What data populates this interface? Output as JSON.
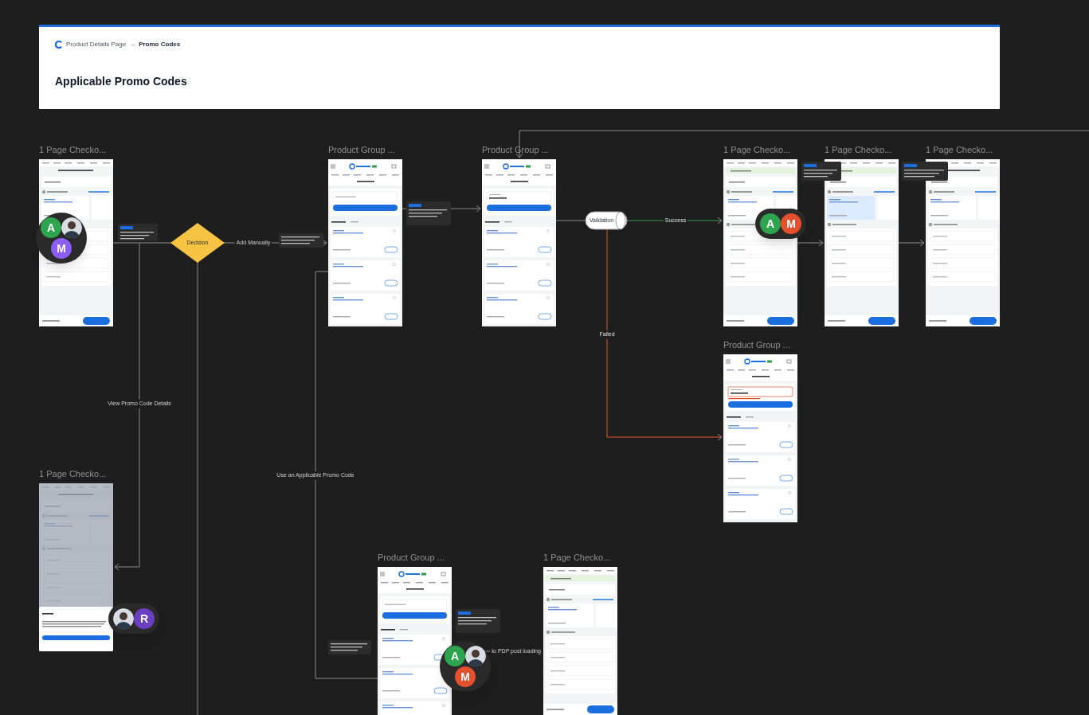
{
  "header": {
    "breadcrumb": [
      "Product Details Page",
      "→",
      "Promo Codes"
    ],
    "title": "Applicable Promo Codes"
  },
  "frames": [
    {
      "kind": "checkout",
      "title": "1 Page Checko...",
      "toast": false,
      "offer_selected": false,
      "details_sheet": false
    },
    {
      "kind": "promo_codes",
      "title": "Product Group ...",
      "filled": false,
      "invalid": false
    },
    {
      "kind": "promo_codes",
      "title": "Product Group ...",
      "filled": true,
      "invalid": false
    },
    {
      "kind": "checkout",
      "title": "1 Page Checko...",
      "toast": true,
      "offer_selected": false,
      "details_sheet": false
    },
    {
      "kind": "checkout",
      "title": "1 Page Checko...",
      "toast": true,
      "offer_selected": true,
      "details_sheet": false
    },
    {
      "kind": "checkout",
      "title": "1 Page Checko...",
      "toast": false,
      "offer_selected": false,
      "details_sheet": false
    },
    {
      "kind": "promo_codes",
      "title": "Product Group ...",
      "filled": true,
      "invalid": true
    },
    {
      "kind": "checkout",
      "title": "1 Page Checko...",
      "toast": false,
      "offer_selected": false,
      "details_sheet": true
    },
    {
      "kind": "promo_codes",
      "title": "Product Group ...",
      "filled": false,
      "invalid": false
    },
    {
      "kind": "checkout",
      "title": "1 Page Checko...",
      "toast": true,
      "offer_selected": false,
      "details_sheet": false
    }
  ],
  "decision": "Decision",
  "validation": "Validation",
  "connectors": [
    {
      "label": "Add Manually",
      "kind": "plain"
    },
    {
      "label": "Success",
      "kind": "success"
    },
    {
      "label": "Failed",
      "kind": "failed"
    },
    {
      "label": "View Promo Code Details",
      "kind": "plain"
    },
    {
      "label": "Use an Applicable Promo Code",
      "kind": "plain"
    },
    {
      "label": "to PDP post loading",
      "kind": "plain"
    }
  ],
  "collaborators": [
    {
      "members": [
        {
          "kind": "letter",
          "letter": "A",
          "color": "#2ea44f"
        },
        {
          "kind": "photo"
        },
        {
          "kind": "letter",
          "letter": "M",
          "color": "#8b5cf6"
        }
      ]
    },
    {
      "members": [
        {
          "kind": "letter",
          "letter": "A",
          "color": "#2ea44f"
        },
        {
          "kind": "letter",
          "letter": "M",
          "color": "#e5502e"
        }
      ]
    },
    {
      "members": [
        {
          "kind": "photo"
        },
        {
          "kind": "letter",
          "letter": "R",
          "color": "#6b3fc2"
        }
      ]
    },
    {
      "members": [
        {
          "kind": "letter",
          "letter": "A",
          "color": "#2ea44f"
        },
        {
          "kind": "photo"
        },
        {
          "kind": "letter",
          "letter": "M",
          "color": "#e5502e"
        }
      ]
    }
  ]
}
